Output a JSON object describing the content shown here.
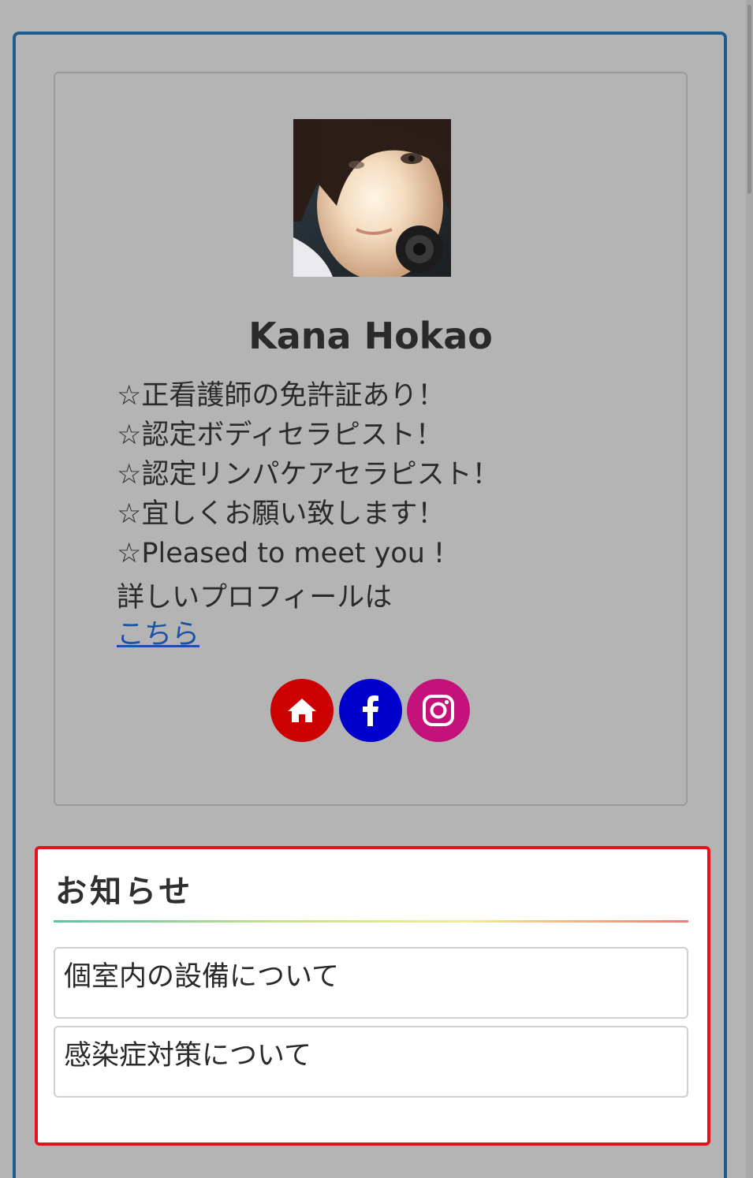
{
  "profile": {
    "name": "Kana Hokao",
    "bio_lines": [
      "☆正看護師の免許証あり！",
      "☆認定ボディセラピスト！",
      "☆認定リンパケアセラピスト！",
      "☆宜しくお願い致します！",
      "☆Pleased to meet you !"
    ],
    "more_text": "詳しいプロフィールは",
    "more_link": "こちら",
    "social": [
      {
        "icon": "home-icon",
        "color": "#cc0000"
      },
      {
        "icon": "facebook-icon",
        "color": "#0000cc"
      },
      {
        "icon": "instagram-icon",
        "color": "#c4127a"
      }
    ]
  },
  "news": {
    "title": "お知らせ",
    "items": [
      "個室内の設備について",
      "感染症対策について"
    ]
  },
  "colors": {
    "frame_border": "#1e5b8d",
    "highlight_border": "#e8101a",
    "link": "#1a53a6",
    "overlay_gray": "#b4b4b4"
  }
}
